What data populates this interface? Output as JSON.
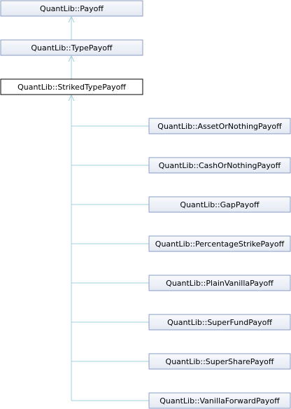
{
  "colors": {
    "box_fill_top": "#f7f9fc",
    "box_fill_bottom": "#e3e9f4",
    "box_border": "#8a9dc0",
    "selected_fill": "#ffffff",
    "selected_border": "#000000",
    "edge": "#9fd0e3"
  },
  "classes": {
    "payoff": "QuantLib::Payoff",
    "type_payoff": "QuantLib::TypePayoff",
    "striked_type_payoff": "QuantLib::StrikedTypePayoff"
  },
  "derived": [
    "QuantLib::AssetOrNothingPayoff",
    "QuantLib::CashOrNothingPayoff",
    "QuantLib::GapPayoff",
    "QuantLib::PercentageStrikePayoff",
    "QuantLib::PlainVanillaPayoff",
    "QuantLib::SuperFundPayoff",
    "QuantLib::SuperSharePayoff",
    "QuantLib::VanillaForwardPayoff"
  ]
}
